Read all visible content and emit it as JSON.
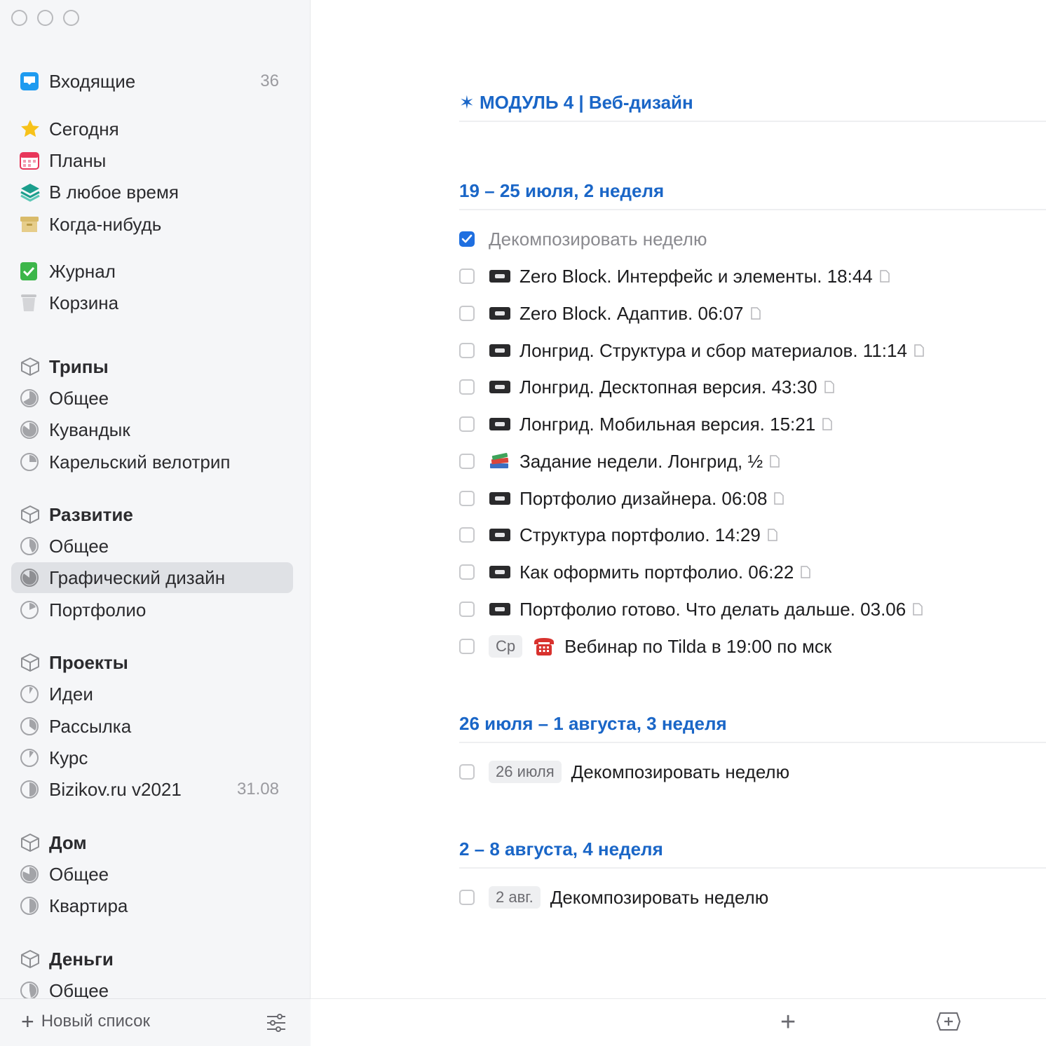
{
  "sidebar": {
    "inbox": {
      "label": "Входящие",
      "count": "36"
    },
    "today": {
      "label": "Сегодня"
    },
    "upcoming": {
      "label": "Планы"
    },
    "anytime": {
      "label": "В любое время"
    },
    "someday": {
      "label": "Когда-нибудь"
    },
    "logbook": {
      "label": "Журнал"
    },
    "trash": {
      "label": "Корзина"
    },
    "areas": [
      {
        "label": "Трипы",
        "projects": [
          {
            "label": "Общее"
          },
          {
            "label": "Кувандык"
          },
          {
            "label": "Карельский велотрип"
          }
        ]
      },
      {
        "label": "Развитие",
        "projects": [
          {
            "label": "Общее"
          },
          {
            "label": "Графический дизайн"
          },
          {
            "label": "Портфолио"
          }
        ]
      },
      {
        "label": "Проекты",
        "projects": [
          {
            "label": "Идеи"
          },
          {
            "label": "Рассылка"
          },
          {
            "label": "Курс"
          },
          {
            "label": "Bizikov.ru v2021",
            "count": "31.08"
          }
        ]
      },
      {
        "label": "Дом",
        "projects": [
          {
            "label": "Общее"
          },
          {
            "label": "Квартира"
          }
        ]
      },
      {
        "label": "Деньги",
        "projects": [
          {
            "label": "Общее"
          }
        ]
      }
    ],
    "new_list_label": "Новый список"
  },
  "main": {
    "headings": [
      {
        "label": "✶ МОДУЛЬ 4 | Веб-дизайн"
      },
      {
        "label": "19 – 25 июля, 2 неделя"
      },
      {
        "label": "26 июля – 1 августа, 3 неделя"
      },
      {
        "label": "2 – 8 августа, 4 неделя"
      }
    ],
    "week2_tasks": [
      {
        "title": "Декомпозировать неделю",
        "done": true
      },
      {
        "title": "Zero Block. Интерфейс и элементы. 18:44"
      },
      {
        "title": "Zero Block. Адаптив. 06:07"
      },
      {
        "title": "Лонгрид. Структура и сбор материалов. 11:14"
      },
      {
        "title": "Лонгрид. Десктопная версия. 43:30"
      },
      {
        "title": "Лонгрид. Мобильная версия. 15:21"
      },
      {
        "title": "Задание недели. Лонгрид, ½"
      },
      {
        "title": "Портфолио дизайнера. 06:08"
      },
      {
        "title": "Структура портфолио. 14:29"
      },
      {
        "title": "Как оформить портфолио. 06:22"
      },
      {
        "title": "Портфолио готово. Что делать дальше. 03.06"
      },
      {
        "title": "Вебинар по Tilda в 19:00 по мск",
        "tag": "Ср"
      }
    ],
    "week3_tasks": [
      {
        "title": "Декомпозировать неделю",
        "tag": "26 июля"
      }
    ],
    "week4_tasks": [
      {
        "title": "Декомпозировать неделю",
        "tag": "2 авг."
      }
    ]
  },
  "colors": {
    "accent": "#1a66c7",
    "checkbox_checked": "#1f6fe0",
    "sidebar_bg": "#f5f6f8"
  }
}
